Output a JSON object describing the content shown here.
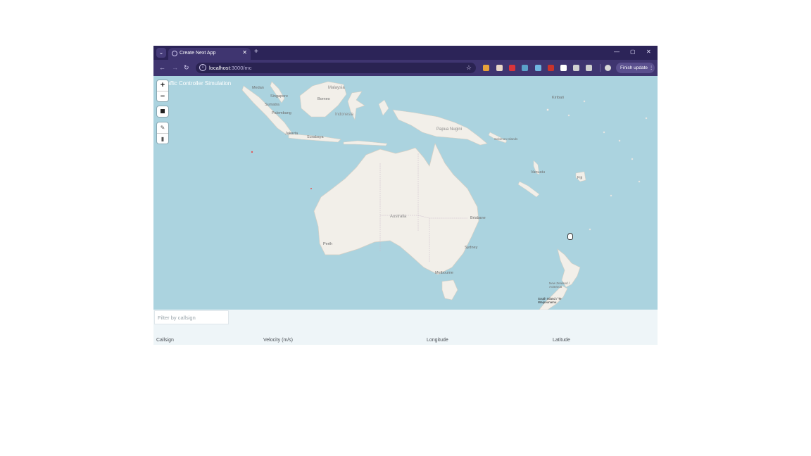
{
  "browser": {
    "tab_title": "Create Next App",
    "tab_close": "✕",
    "new_tab": "+",
    "url_host": "localhost",
    "url_path": ":3000/mc",
    "finish_update": "Finish update",
    "extension_colors": [
      "#e8a23a",
      "#e8d7c8",
      "#d8343a",
      "#5aa0c8",
      "#6fb5e0",
      "#c8342c",
      "#ffffff",
      "#d0d0d0",
      "#d0d0d0"
    ]
  },
  "map": {
    "app_title": "Traffic Controller Simulation",
    "zoom_in": "+",
    "zoom_out": "−",
    "icons": {
      "stop": "stop-square-icon",
      "edit": "edit-icon",
      "delete": "trash-icon"
    },
    "labels": [
      "Medan",
      "Malaysia",
      "Singapore",
      "Sumatra",
      "Borneo",
      "Palembang",
      "Indonesia",
      "Jakarta",
      "Surabaya",
      "Papua Nugini",
      "Solomon Islands",
      "Kiribati",
      "Vanuatu",
      "Fiji",
      "Australia",
      "Brisbane",
      "Perth",
      "Sydney",
      "Melbourne",
      "New Zealand / Aotearoa",
      "South Island / Te Waipounamu"
    ]
  },
  "table": {
    "filter_placeholder": "Filter by callsign",
    "columns": [
      "Callsign",
      "Velocity (m/s)",
      "Longitude",
      "Latitude"
    ]
  }
}
